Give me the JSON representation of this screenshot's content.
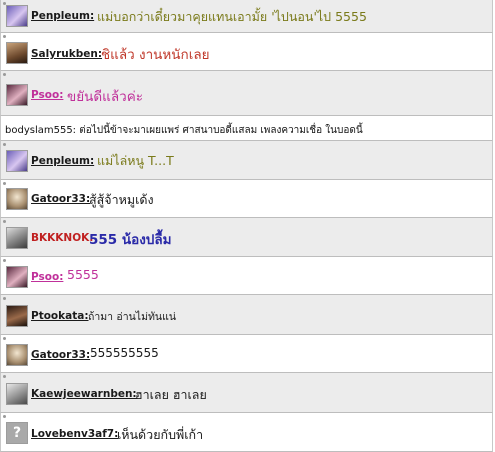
{
  "messages": [
    {
      "user": "Penpleum:",
      "text": "แม่บอกว่าเดี๋ยวมาคุยแทนเอามั้ย 'ไปนอน'ไป 5555",
      "user_color": "#1a1a1a",
      "text_color": "#7a7a1a"
    },
    {
      "user": "Salyrukben:",
      "text": "ชิแล้ว งานหนักเลย",
      "user_color": "#1a1a1a",
      "text_color": "#c0392b"
    },
    {
      "user": "Psoo:",
      "text": "ขยันดีแล้วค่ะ",
      "user_color": "#c0309a",
      "text_color": "#c0309a"
    },
    {
      "user": "",
      "text": "bodyslam555: ต่อไปนี้ข้าจะมาเผยแพร่ ศาสนาบอดี้แสลม เพลงความเชื่อ ในบอดนี้",
      "user_color": "#111111",
      "text_color": "#111111"
    },
    {
      "user": "Penpleum:",
      "text": "แม่ไล่หนู T...T",
      "user_color": "#1a1a1a",
      "text_color": "#7a7a1a"
    },
    {
      "user": "Gatoor33:",
      "text": "สู้สู้จ้าหมูเด้ง",
      "user_color": "#1a1a1a",
      "text_color": "#1a1a1a"
    },
    {
      "user": "BKKKNOK:",
      "text": "555 น้องปลื้ม",
      "user_color": "#c02020",
      "text_color": "#2a2aa8"
    },
    {
      "user": "Psoo:",
      "text": "5555",
      "user_color": "#c0309a",
      "text_color": "#c0309a"
    },
    {
      "user": "Ptookata:",
      "text": "ถ้ามา อ่านไม่ทันแน่",
      "user_color": "#1a1a1a",
      "text_color": "#1a1a1a"
    },
    {
      "user": "Gatoor33:",
      "text": "555555555",
      "user_color": "#1a1a1a",
      "text_color": "#1a1a1a"
    },
    {
      "user": "Kaewjeewarnben:",
      "text": "ฮาเลย ฮาเลย",
      "user_color": "#1a1a1a",
      "text_color": "#1a1a1a"
    },
    {
      "user": "Lovebenv3af7:",
      "text": "เห็นด้วยกับพี่เก้า",
      "user_color": "#1a1a1a",
      "text_color": "#1a1a1a"
    }
  ],
  "avatars": {
    "default_glyph": "?"
  }
}
